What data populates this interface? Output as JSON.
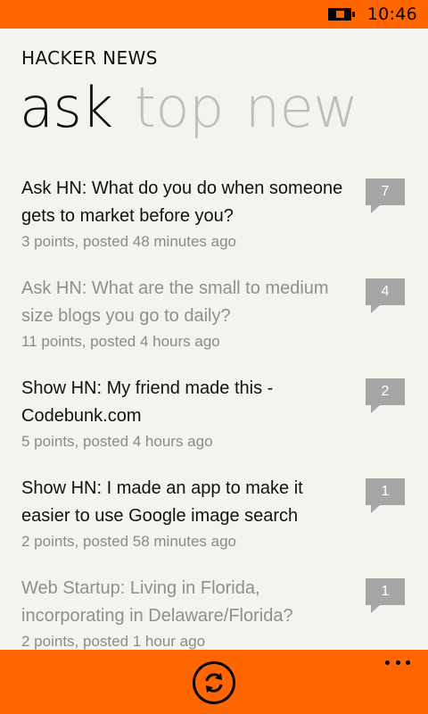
{
  "status": {
    "time": "10:46"
  },
  "app": {
    "title": "HACKER NEWS"
  },
  "pivot": {
    "tabs": [
      {
        "label": "ask",
        "active": true
      },
      {
        "label": "top",
        "active": false
      },
      {
        "label": "new",
        "active": false
      }
    ]
  },
  "stories": [
    {
      "title": "Ask HN: What do you do when someone gets to market before you?",
      "meta": "3 points, posted 48 minutes ago",
      "comments": "7",
      "read": false
    },
    {
      "title": "Ask HN: What are the small to medium size blogs you go to daily?",
      "meta": "11 points, posted 4 hours ago",
      "comments": "4",
      "read": true
    },
    {
      "title": "Show HN: My friend made this - Codebunk.com",
      "meta": "5 points, posted 4 hours ago",
      "comments": "2",
      "read": false
    },
    {
      "title": "Show HN: I made an app to make it easier to use Google image search",
      "meta": "2 points, posted 58 minutes ago",
      "comments": "1",
      "read": false
    },
    {
      "title": "Web Startup: Living in Florida, incorporating in Delaware/Florida?",
      "meta": "2 points, posted 1 hour ago",
      "comments": "1",
      "read": true
    }
  ],
  "appbar": {
    "refresh_icon": "refresh-icon",
    "more_icon": "ellipsis-icon"
  },
  "colors": {
    "accent": "#ff6600",
    "background": "#f4f3ee",
    "read_text": "#8f8f8f",
    "comment_badge": "#a6a6a6"
  }
}
